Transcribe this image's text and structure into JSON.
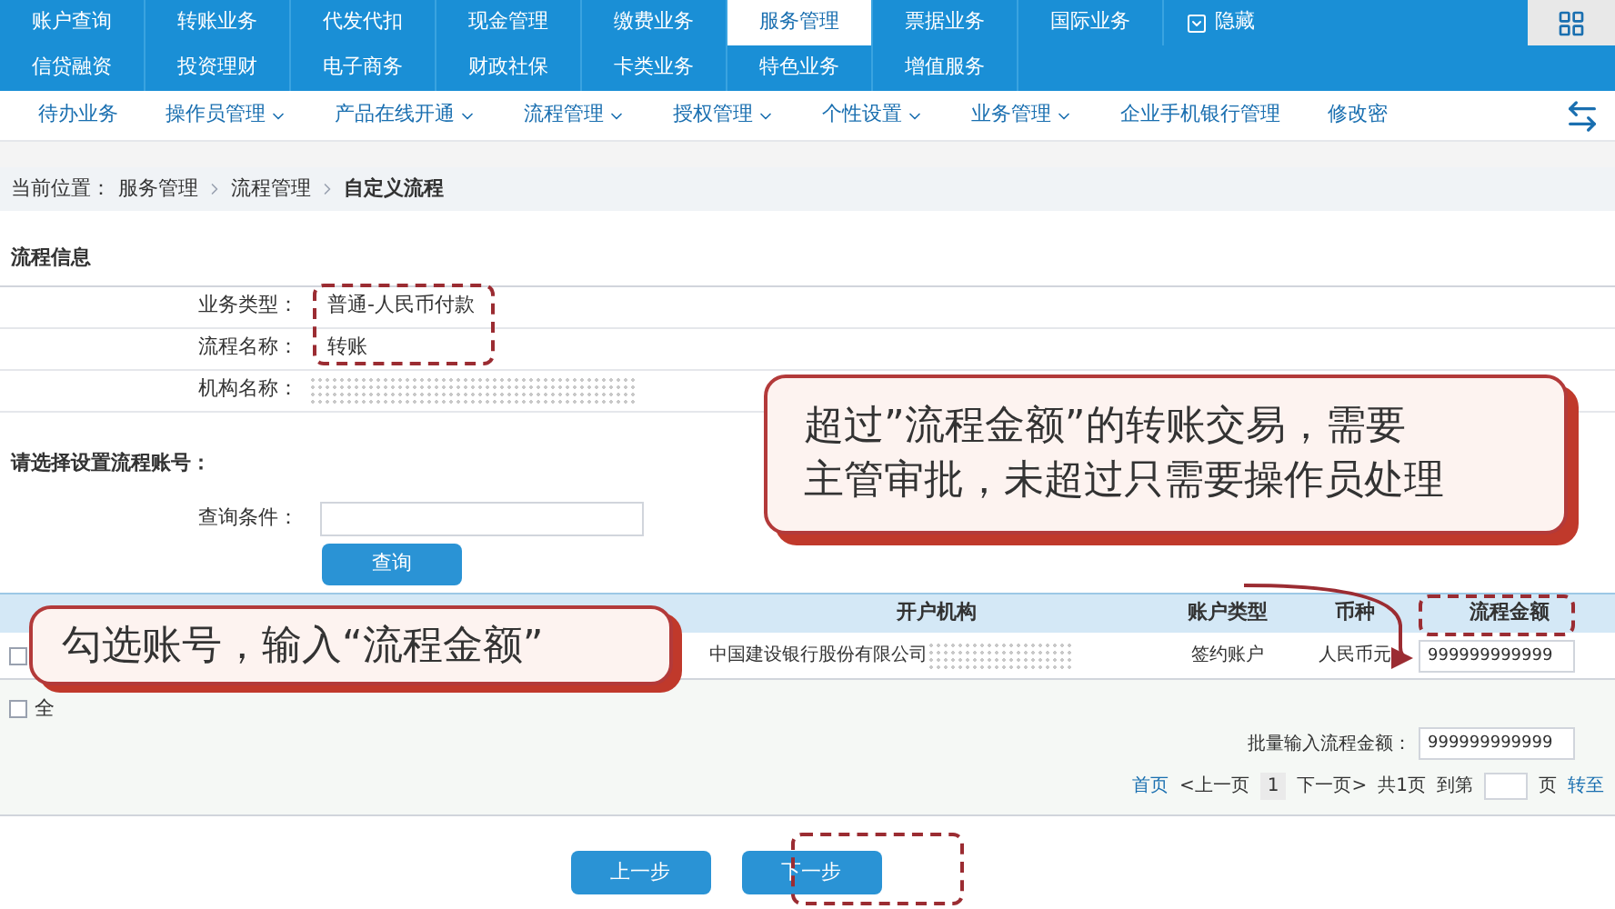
{
  "top_nav": {
    "rows": [
      [
        {
          "label": "账户查询",
          "selected": false
        },
        {
          "label": "转账业务",
          "selected": false
        },
        {
          "label": "代发代扣",
          "selected": false
        },
        {
          "label": "现金管理",
          "selected": false
        },
        {
          "label": "缴费业务",
          "selected": false
        },
        {
          "label": "服务管理",
          "selected": true
        },
        {
          "label": "票据业务",
          "selected": false
        },
        {
          "label": "国际业务",
          "selected": false
        }
      ],
      [
        {
          "label": "信贷融资",
          "selected": false
        },
        {
          "label": "投资理财",
          "selected": false
        },
        {
          "label": "电子商务",
          "selected": false
        },
        {
          "label": "财政社保",
          "selected": false
        },
        {
          "label": "卡类业务",
          "selected": false
        },
        {
          "label": "特色业务",
          "selected": false
        },
        {
          "label": "增值服务",
          "selected": false
        }
      ]
    ],
    "hide_toggle": "隐藏"
  },
  "sub_nav": [
    {
      "label": "待办业务",
      "has_menu": false
    },
    {
      "label": "操作员管理",
      "has_menu": true
    },
    {
      "label": "产品在线开通",
      "has_menu": true
    },
    {
      "label": "流程管理",
      "has_menu": true
    },
    {
      "label": "授权管理",
      "has_menu": true
    },
    {
      "label": "个性设置",
      "has_menu": true
    },
    {
      "label": "业务管理",
      "has_menu": true
    },
    {
      "label": "企业手机银行管理",
      "has_menu": false
    },
    {
      "label": "修改密",
      "has_menu": false
    }
  ],
  "breadcrumb": {
    "prefix": "当前位置：",
    "items": [
      "服务管理",
      "流程管理",
      "自定义流程"
    ]
  },
  "process_info": {
    "title": "流程信息",
    "fields": [
      {
        "label": "业务类型：",
        "value": "普通-人民币付款",
        "kind": "text"
      },
      {
        "label": "流程名称：",
        "value": "转账",
        "kind": "text"
      },
      {
        "label": "机构名称：",
        "kind": "redacted"
      }
    ]
  },
  "account_select": {
    "title": "请选择设置流程账号：",
    "query_label": "查询条件：",
    "query_button": "查询"
  },
  "table": {
    "columns": [
      "开户机构",
      "账户类型",
      "币种",
      "流程金额"
    ],
    "rows": [
      {
        "checked": false,
        "bank": "中国建设银行股份有限公司",
        "account_type": "签约账户",
        "currency": "人民币元",
        "amount": "999999999999"
      }
    ]
  },
  "select_all": {
    "label": "全",
    "checked": false
  },
  "batch": {
    "label": "批量输入流程金额：",
    "value": "999999999999"
  },
  "pagination": {
    "first": "首页",
    "prev": "<上一页",
    "current": "1",
    "next": "下一页>",
    "total": "共1页",
    "goto_prefix": "到第",
    "goto_suffix": "页",
    "go": "转至"
  },
  "buttons": [
    "上一步",
    "下一步"
  ],
  "annotations": {
    "approval_callout": [
      "超过”流程金额”的转账交易，需要",
      "主管审批，未超过只需要操作员处理"
    ],
    "select_callout": "勾选账号，输入“流程金额”"
  }
}
